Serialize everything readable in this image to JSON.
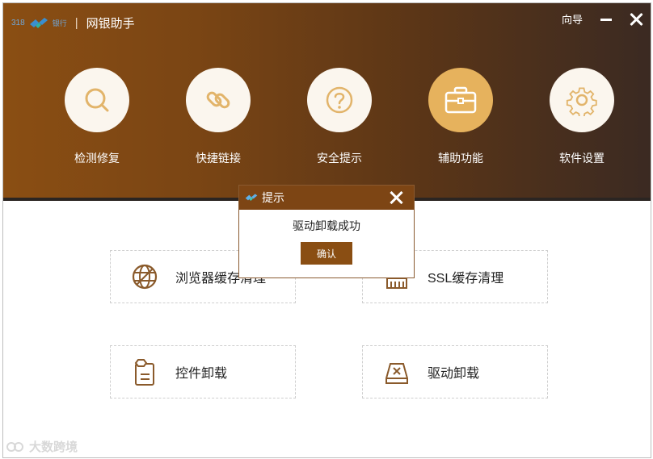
{
  "app": {
    "logo_code": "318",
    "logo_bank": "银行",
    "separator": "|",
    "title": "网银助手",
    "guide_label": "向导"
  },
  "nav": {
    "items": [
      {
        "label": "检测修复",
        "icon": "search-icon",
        "active": false
      },
      {
        "label": "快捷链接",
        "icon": "link-icon",
        "active": false
      },
      {
        "label": "安全提示",
        "icon": "question-icon",
        "active": false
      },
      {
        "label": "辅助功能",
        "icon": "toolbox-icon",
        "active": true
      },
      {
        "label": "软件设置",
        "icon": "gear-icon",
        "active": false
      }
    ]
  },
  "tools": {
    "browser_cache": "浏览器缓存清理",
    "ssl_cache": "SSL缓存清理",
    "control_uninstall": "控件卸载",
    "driver_uninstall": "驱动卸载"
  },
  "dialog": {
    "title": "提示",
    "message": "驱动卸载成功",
    "ok_label": "确认"
  },
  "watermark": {
    "text": "大数跨境"
  },
  "colors": {
    "header_start": "#8a4e13",
    "header_end": "#3b2a22",
    "accent": "#e6b25d",
    "icon_brown": "#8a5a2b",
    "dialog_title": "#7d4514"
  }
}
